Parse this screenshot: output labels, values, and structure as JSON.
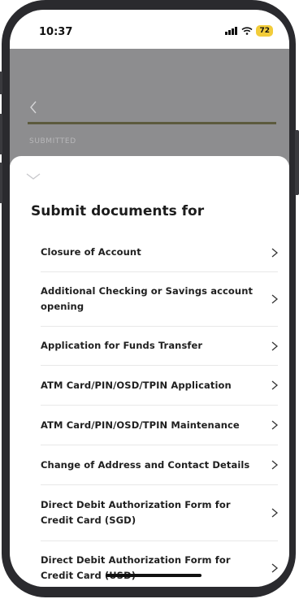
{
  "status": {
    "time": "10:37",
    "battery": "72"
  },
  "header": {
    "step_label": "SUBMITTED"
  },
  "sheet": {
    "title": "Submit documents for",
    "items": [
      {
        "label": "Closure of Account"
      },
      {
        "label": "Additional Checking or Savings account opening"
      },
      {
        "label": "Application for Funds Transfer"
      },
      {
        "label": "ATM Card/PIN/OSD/TPIN Application"
      },
      {
        "label": "ATM Card/PIN/OSD/TPIN Maintenance"
      },
      {
        "label": "Change of Address and Contact Details"
      },
      {
        "label": "Direct Debit Authorization Form for Credit Card (SGD)"
      },
      {
        "label": "Direct Debit Authorization Form for Credit Card (USD)"
      }
    ]
  },
  "colors": {
    "accent": "#5c5a3e",
    "battery": "#f2cc3a",
    "overlay": "#8d8d8f"
  }
}
